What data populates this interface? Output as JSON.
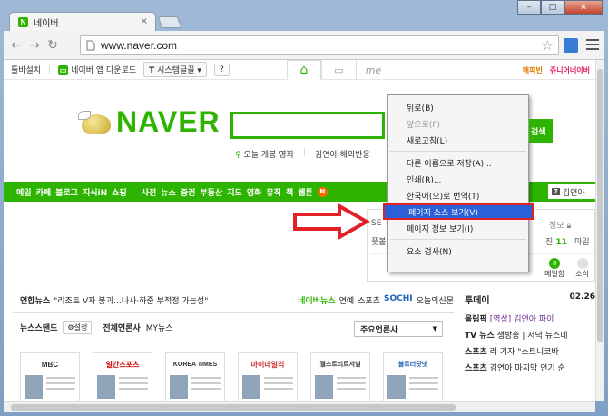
{
  "window": {
    "tab_title": "네이버",
    "tab_close": "×",
    "controls": {
      "minimize": "–",
      "maximize": "□",
      "close": "×"
    }
  },
  "toolbar": {
    "url": "www.naver.com"
  },
  "utility": {
    "toolbar_install": "툴바설치",
    "app_download": "네이버 앱 다운로드",
    "font_button": "시스템글꼴",
    "help_button": "?",
    "happybean": "해피빈",
    "junior": "쥬니어네이버"
  },
  "search": {
    "hot_keywords": [
      "오늘 개봉 영화",
      "김연아 해외반응"
    ],
    "button": "검색"
  },
  "gnb": {
    "items": [
      "메일",
      "카페",
      "블로그",
      "지식iN",
      "쇼핑",
      "사전",
      "뉴스",
      "증권",
      "부동산",
      "지도",
      "영화",
      "뮤직",
      "책",
      "웹툰"
    ],
    "right_badge": "7",
    "right_text": "김연아"
  },
  "login_panel": {
    "line1": "SE",
    "line2": "풋볼",
    "info": "정보",
    "count_label": "진",
    "count": "11",
    "right2": "마일",
    "sub": [
      {
        "badge": "8",
        "label": "메일함"
      },
      {
        "badge": "",
        "label": "소식"
      }
    ]
  },
  "news": {
    "brand": "연합뉴스",
    "headline": "\"리조트 V자 붕괴…나사·하중 부적정 가능성\"",
    "links": [
      "네이버뉴스",
      "연예",
      "스포츠",
      "SOCHI",
      "오늘의신문"
    ]
  },
  "newsstand": {
    "title": "뉴스스탠드",
    "settings": "설정",
    "all_press": "전체언론사",
    "my_news": "MY뉴스",
    "select_value": "주요언론사",
    "press": [
      "MBC",
      "일간스포츠",
      "KOREA TIMES",
      "마이데일리",
      "월스트리트저널",
      "블로터닷넷"
    ]
  },
  "today": {
    "title": "투데이",
    "date": "02.26",
    "rows": [
      {
        "cat": "올림픽",
        "tag": "[영상]",
        "text": "김연아 파이"
      },
      {
        "cat": "TV 뉴스",
        "tag": "",
        "text": "생방송 | 저녁 뉴스데"
      },
      {
        "cat": "스포츠",
        "tag": "",
        "text": "러 기자 \"소트니코바"
      },
      {
        "cat": "스포츠",
        "tag": "",
        "text": "김연아 마지막 연기 순"
      }
    ]
  },
  "context_menu": {
    "items": [
      {
        "label": "뒤로(B)",
        "state": "normal"
      },
      {
        "label": "앞으로(F)",
        "state": "disabled"
      },
      {
        "label": "새로고침(L)",
        "state": "normal"
      },
      {
        "sep": true
      },
      {
        "label": "다른 이름으로 저장(A)...",
        "state": "normal"
      },
      {
        "label": "인쇄(R)...",
        "state": "normal"
      },
      {
        "label": "한국어(으)로 번역(T)",
        "state": "normal"
      },
      {
        "label": "페이지 소스 보기(V)",
        "state": "selected"
      },
      {
        "label": "페이지 정보 보기(I)",
        "state": "normal"
      },
      {
        "sep": true
      },
      {
        "label": "요소 검사(N)",
        "state": "normal"
      }
    ]
  },
  "colors": {
    "naver_green": "#2db400",
    "highlight": "#2a60d8",
    "annotation_red": "#e32025"
  }
}
